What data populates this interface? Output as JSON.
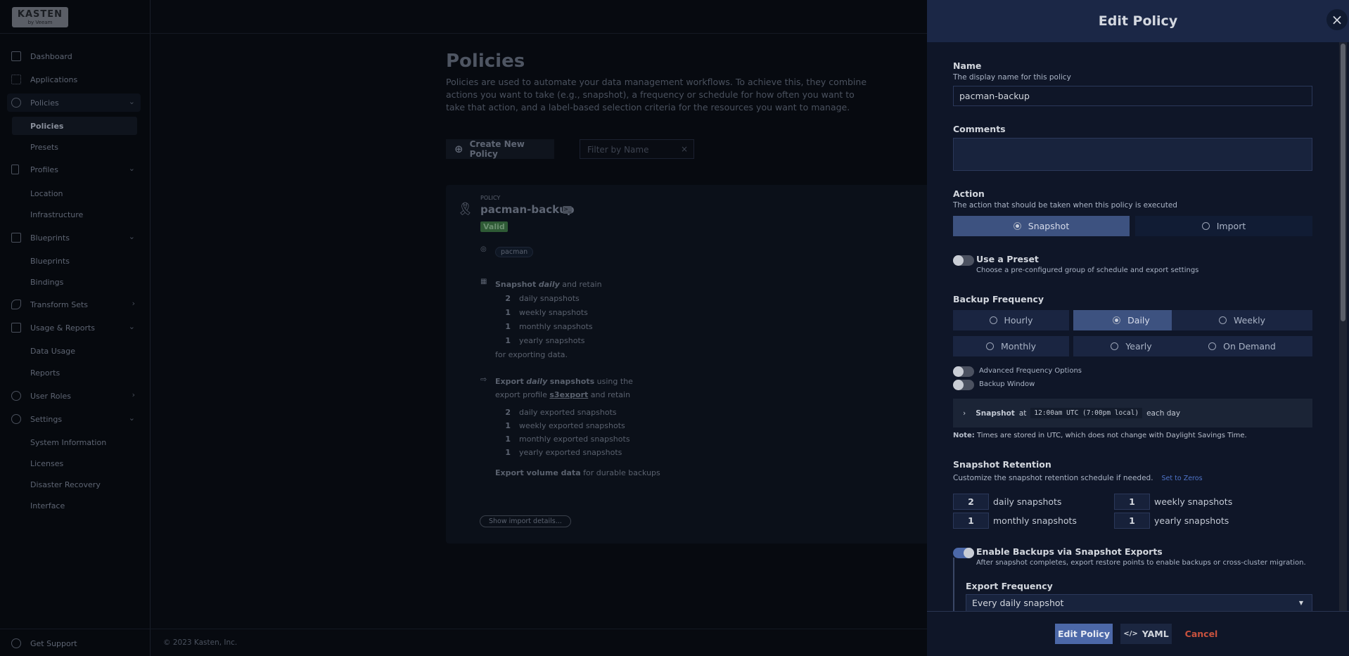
{
  "logo": {
    "brand": "KASTEN",
    "sub": "by Veeam"
  },
  "sidebar": {
    "items": [
      {
        "label": "Dashboard"
      },
      {
        "label": "Applications"
      },
      {
        "label": "Policies"
      },
      {
        "label": "Policies"
      },
      {
        "label": "Presets"
      },
      {
        "label": "Profiles"
      },
      {
        "label": "Location"
      },
      {
        "label": "Infrastructure"
      },
      {
        "label": "Blueprints"
      },
      {
        "label": "Blueprints"
      },
      {
        "label": "Bindings"
      },
      {
        "label": "Transform Sets"
      },
      {
        "label": "Usage & Reports"
      },
      {
        "label": "Data Usage"
      },
      {
        "label": "Reports"
      },
      {
        "label": "User Roles"
      },
      {
        "label": "Settings"
      },
      {
        "label": "System Information"
      },
      {
        "label": "Licenses"
      },
      {
        "label": "Disaster Recovery"
      },
      {
        "label": "Interface"
      }
    ],
    "support": "Get Support"
  },
  "footer": {
    "copyright": "© 2023 Kasten, Inc."
  },
  "main": {
    "title": "Policies",
    "description": "Policies are used to automate your data management workflows. To achieve this, they combine actions you want to take (e.g., snapshot), a frequency or schedule for how often you want to take that action, and a label-based selection criteria for the resources you want to manage.",
    "create_label": "Create New Policy",
    "filter_placeholder": "Filter by Name",
    "card": {
      "kind": "POLICY",
      "name": "pacman-backup",
      "status": "Valid",
      "app": "pacman",
      "snap_a": "Snapshot",
      "snap_b": "daily",
      "snap_c": "and retain",
      "retention": [
        {
          "n": "2",
          "label": "daily snapshots"
        },
        {
          "n": "1",
          "label": "weekly snapshots"
        },
        {
          "n": "1",
          "label": "monthly snapshots"
        },
        {
          "n": "1",
          "label": "yearly snapshots"
        }
      ],
      "for_export": "for exporting data.",
      "exp_a": "Export",
      "exp_b": "daily",
      "exp_c": "snapshots",
      "exp_d": "using the",
      "exp_e": "export profile",
      "exp_profile": "s3export",
      "exp_f": "and retain",
      "export_retention": [
        {
          "n": "2",
          "label": "daily exported snapshots"
        },
        {
          "n": "1",
          "label": "weekly exported snapshots"
        },
        {
          "n": "1",
          "label": "monthly exported snapshots"
        },
        {
          "n": "1",
          "label": "yearly exported snapshots"
        }
      ],
      "vol_a": "Export volume data",
      "vol_b": "for durable backups",
      "import_btn": "Show import details..."
    }
  },
  "drawer": {
    "title": "Edit Policy",
    "name_label": "Name",
    "name_desc": "The display name for this policy",
    "name_value": "pacman-backup",
    "comments_label": "Comments",
    "action_label": "Action",
    "action_desc": "The action that should be taken when this policy is executed",
    "action_opts": [
      "Snapshot",
      "Import"
    ],
    "preset_label": "Use a Preset",
    "preset_desc": "Choose a pre-configured group of schedule and export settings",
    "freq_label": "Backup Frequency",
    "freq_opts": [
      "Hourly",
      "Daily",
      "Weekly",
      "Monthly",
      "Yearly",
      "On Demand"
    ],
    "adv": "Advanced Frequency Options",
    "window": "Backup Window",
    "sched_a": "Snapshot",
    "sched_b": "at",
    "sched_time": "12:00am UTC (7:00pm local)",
    "sched_c": "each day",
    "note_b": "Note:",
    "note": "Times are stored in UTC, which does not change with Daylight Savings Time.",
    "ret_label": "Snapshot Retention",
    "ret_desc": "Customize the snapshot retention schedule if needed.",
    "ret_link": "Set to Zeros",
    "ret": [
      {
        "n": "2",
        "label": "daily snapshots"
      },
      {
        "n": "1",
        "label": "weekly snapshots"
      },
      {
        "n": "1",
        "label": "monthly snapshots"
      },
      {
        "n": "1",
        "label": "yearly snapshots"
      }
    ],
    "exp_label": "Enable Backups via Snapshot Exports",
    "exp_desc": "After snapshot completes, export restore points to enable backups or cross-cluster migration.",
    "expfreq_label": "Export Frequency",
    "expfreq_value": "Every daily snapshot",
    "btn_edit": "Edit Policy",
    "btn_yaml": "YAML",
    "btn_cancel": "Cancel"
  }
}
